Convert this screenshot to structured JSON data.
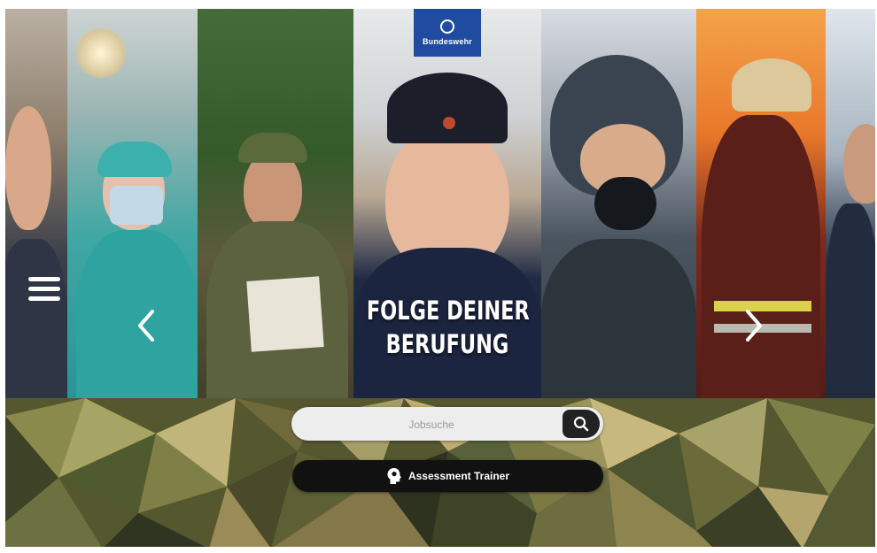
{
  "brand": {
    "logo_text": "Bundeswehr",
    "logo_color": "#1f4ca0"
  },
  "hero": {
    "headline_line1": "FOLGE DEINER",
    "headline_line2": "BERUFUNG"
  },
  "search": {
    "placeholder": "Jobsuche"
  },
  "assessment": {
    "label": "Assessment Trainer"
  },
  "icons": {
    "menu": "hamburger-menu-icon",
    "prev": "chevron-left-icon",
    "next": "chevron-right-icon",
    "search": "search-icon",
    "trainer": "head-profile-icon"
  },
  "strips": [
    "office-officer",
    "surgeon",
    "soldier-camouflage",
    "soldier-cap",
    "pilot",
    "firefighter",
    "navy-officer"
  ]
}
